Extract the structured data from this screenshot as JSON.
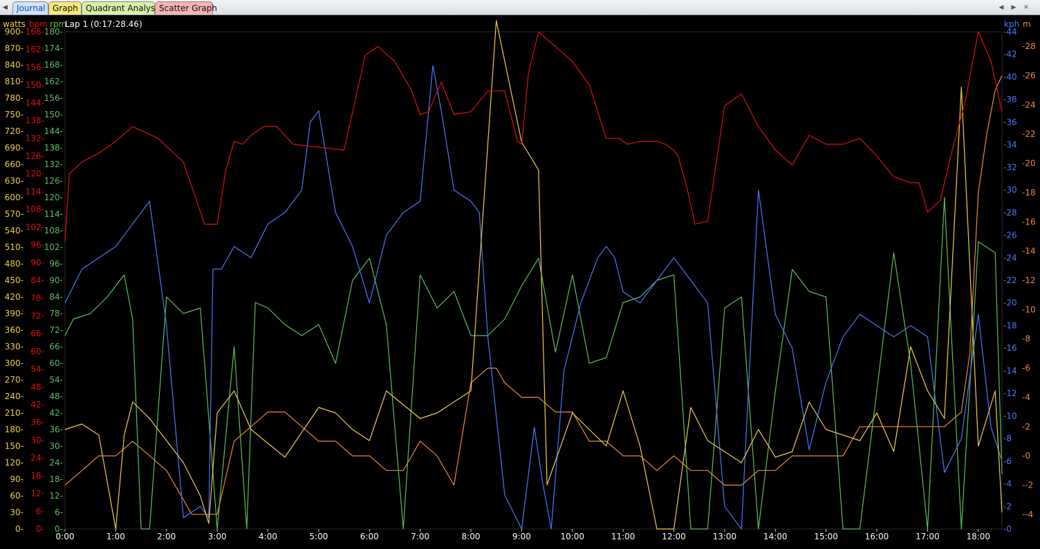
{
  "tabs": [
    {
      "label": "Journal"
    },
    {
      "label": "Graph"
    },
    {
      "label": "Quadrant Analysis"
    },
    {
      "label": "Scatter Graph"
    }
  ],
  "graph": {
    "lap_label": "Lap 1  (0:17:28.46)",
    "units": {
      "watts": "watts",
      "bpm": "bpm",
      "rpm": "rpm",
      "kph": "kph",
      "m": "m"
    },
    "colors": {
      "watts": "#f2d04a",
      "bpm": "#e01010",
      "rpm": "#5cc15c",
      "kph": "#4a78ff",
      "m": "#f08a3a",
      "time": "#ffffff"
    }
  },
  "chart_data": {
    "type": "line",
    "x_unit": "time (m:ss)",
    "xlim": [
      0,
      1108
    ],
    "x_ticks": [
      "0:00",
      "1:00",
      "2:00",
      "3:00",
      "4:00",
      "5:00",
      "6:00",
      "7:00",
      "8:00",
      "9:00",
      "10:00",
      "11:00",
      "12:00",
      "13:00",
      "14:00",
      "15:00",
      "16:00",
      "17:00",
      "18:00"
    ],
    "axes": {
      "watts": {
        "range": [
          0,
          900
        ],
        "ticks": [
          0,
          30,
          60,
          90,
          120,
          150,
          180,
          210,
          240,
          270,
          300,
          330,
          360,
          390,
          420,
          450,
          480,
          510,
          540,
          570,
          600,
          630,
          660,
          690,
          720,
          750,
          780,
          810,
          840,
          870,
          900
        ]
      },
      "bpm": {
        "range": [
          0,
          168
        ],
        "ticks": [
          0,
          6,
          12,
          18,
          24,
          30,
          36,
          42,
          48,
          54,
          60,
          66,
          72,
          78,
          84,
          90,
          96,
          102,
          108,
          114,
          120,
          126,
          132,
          138,
          144,
          150,
          156,
          162,
          168
        ]
      },
      "rpm": {
        "range": [
          0,
          180
        ],
        "ticks": [
          0,
          6,
          12,
          18,
          24,
          30,
          36,
          42,
          48,
          54,
          60,
          66,
          72,
          78,
          84,
          90,
          96,
          102,
          108,
          114,
          120,
          126,
          132,
          138,
          144,
          150,
          156,
          162,
          168,
          174,
          180
        ]
      },
      "kph": {
        "range": [
          0,
          44
        ],
        "ticks": [
          0,
          2,
          4,
          6,
          8,
          10,
          12,
          14,
          16,
          18,
          20,
          22,
          24,
          26,
          28,
          30,
          32,
          34,
          36,
          38,
          40,
          42,
          44
        ]
      },
      "m": {
        "range": [
          -5,
          29
        ],
        "ticks": [
          -4,
          -2,
          0,
          2,
          4,
          6,
          8,
          10,
          12,
          14,
          16,
          18,
          20,
          22,
          24,
          26,
          28
        ]
      }
    },
    "series": [
      {
        "name": "bpm",
        "axis": "bpm",
        "x": [
          0,
          5,
          20,
          40,
          60,
          80,
          110,
          140,
          165,
          180,
          190,
          200,
          210,
          220,
          235,
          250,
          270,
          300,
          330,
          355,
          370,
          390,
          410,
          420,
          430,
          445,
          460,
          480,
          500,
          520,
          528,
          535,
          540,
          548,
          560,
          580,
          600,
          620,
          640,
          655,
          665,
          680,
          690,
          700,
          710,
          720,
          725,
          735,
          745,
          760,
          780,
          800,
          820,
          840,
          860,
          880,
          900,
          920,
          940,
          960,
          980,
          1000,
          1010,
          1020,
          1035,
          1050,
          1065,
          1080,
          1095,
          1108
        ],
        "values": [
          97,
          120,
          124,
          127,
          131,
          136,
          132,
          124,
          103,
          103,
          121,
          131,
          130,
          133,
          136,
          136,
          130,
          129,
          128,
          160,
          163,
          158,
          148,
          140,
          141,
          151,
          140,
          141,
          148,
          148,
          139,
          131,
          130,
          154,
          168,
          163,
          158,
          150,
          132,
          132,
          130,
          131,
          131,
          131,
          130,
          128,
          126,
          116,
          103,
          104,
          143,
          147,
          136,
          128,
          123,
          133,
          130,
          130,
          132,
          126,
          119,
          117,
          117,
          107,
          111,
          129,
          145,
          168,
          158,
          141
        ]
      },
      {
        "name": "watts",
        "axis": "watts",
        "x": [
          0,
          20,
          40,
          60,
          70,
          80,
          100,
          140,
          160,
          170,
          180,
          200,
          220,
          260,
          300,
          320,
          340,
          360,
          380,
          420,
          440,
          460,
          480,
          510,
          540,
          560,
          570,
          600,
          620,
          640,
          660,
          680,
          700,
          720,
          740,
          760,
          800,
          820,
          840,
          860,
          880,
          900,
          940,
          960,
          980,
          1000,
          1020,
          1040,
          1060,
          1080,
          1100,
          1108
        ],
        "values": [
          180,
          190,
          170,
          0,
          170,
          230,
          200,
          120,
          60,
          10,
          210,
          250,
          180,
          130,
          220,
          210,
          180,
          160,
          250,
          200,
          210,
          230,
          250,
          920,
          700,
          650,
          80,
          210,
          180,
          150,
          250,
          150,
          0,
          0,
          220,
          160,
          120,
          180,
          130,
          140,
          230,
          180,
          160,
          210,
          140,
          330,
          250,
          200,
          800,
          150,
          250,
          30
        ]
      },
      {
        "name": "rpm",
        "axis": "rpm",
        "x": [
          0,
          10,
          30,
          50,
          70,
          80,
          90,
          100,
          120,
          140,
          160,
          180,
          200,
          215,
          225,
          240,
          260,
          280,
          300,
          320,
          340,
          360,
          380,
          400,
          420,
          440,
          460,
          480,
          500,
          520,
          540,
          560,
          580,
          600,
          620,
          640,
          660,
          680,
          700,
          720,
          740,
          760,
          780,
          800,
          820,
          840,
          860,
          880,
          900,
          920,
          940,
          960,
          980,
          1000,
          1020,
          1040,
          1060,
          1080,
          1100,
          1108
        ],
        "values": [
          70,
          76,
          78,
          84,
          92,
          76,
          0,
          0,
          84,
          78,
          80,
          0,
          66,
          0,
          82,
          80,
          74,
          70,
          74,
          60,
          90,
          98,
          74,
          0,
          92,
          80,
          86,
          70,
          70,
          76,
          88,
          98,
          64,
          92,
          60,
          62,
          82,
          84,
          90,
          92,
          0,
          0,
          80,
          84,
          0,
          50,
          94,
          86,
          84,
          0,
          0,
          50,
          100,
          60,
          0,
          120,
          0,
          104,
          100,
          20
        ]
      },
      {
        "name": "kph",
        "axis": "kph",
        "x": [
          0,
          20,
          40,
          60,
          80,
          100,
          120,
          140,
          160,
          170,
          175,
          185,
          200,
          220,
          240,
          260,
          280,
          290,
          300,
          320,
          340,
          360,
          380,
          400,
          420,
          435,
          445,
          460,
          480,
          490,
          500,
          520,
          540,
          555,
          565,
          575,
          590,
          600,
          610,
          620,
          630,
          640,
          650,
          660,
          680,
          700,
          720,
          740,
          760,
          780,
          800,
          820,
          840,
          860,
          880,
          900,
          920,
          940,
          960,
          980,
          1000,
          1020,
          1040,
          1060,
          1080,
          1095,
          1108
        ],
        "values": [
          20,
          23,
          24,
          25,
          27,
          29,
          18,
          1,
          2,
          1,
          23,
          23,
          25,
          24,
          27,
          28,
          30,
          36,
          37,
          28,
          25,
          20,
          26,
          28,
          29,
          41,
          37,
          30,
          29,
          28,
          17,
          3,
          0,
          9,
          4,
          0,
          14,
          17,
          20,
          22,
          24,
          25,
          24,
          21,
          20,
          22,
          24,
          22,
          20,
          2,
          0,
          30,
          19,
          16,
          7,
          13,
          17,
          19,
          18,
          17,
          18,
          17,
          5,
          8,
          19,
          9,
          6
        ]
      },
      {
        "name": "m",
        "axis": "m",
        "x": [
          0,
          20,
          40,
          60,
          80,
          100,
          120,
          150,
          170,
          180,
          200,
          220,
          240,
          260,
          280,
          300,
          320,
          340,
          360,
          380,
          400,
          420,
          440,
          460,
          480,
          500,
          510,
          520,
          540,
          560,
          580,
          600,
          620,
          640,
          660,
          680,
          700,
          720,
          740,
          760,
          780,
          800,
          820,
          840,
          860,
          880,
          900,
          920,
          940,
          960,
          980,
          1000,
          1020,
          1040,
          1060,
          1070,
          1080,
          1090,
          1100,
          1108
        ],
        "values": [
          -2,
          -1,
          0,
          0,
          1,
          0,
          -1,
          -4,
          -4,
          -4,
          1,
          2,
          3,
          3,
          2,
          1,
          1,
          0,
          0,
          -1,
          -1,
          1,
          0,
          -2,
          5,
          6,
          6,
          5,
          4,
          4,
          3,
          3,
          1,
          1,
          0,
          0,
          -1,
          0,
          -1,
          -1,
          -2,
          -2,
          -1,
          -1,
          0,
          0,
          0,
          0,
          2,
          2,
          2,
          2,
          2,
          2,
          3,
          7,
          18,
          22,
          25,
          26
        ]
      }
    ]
  }
}
